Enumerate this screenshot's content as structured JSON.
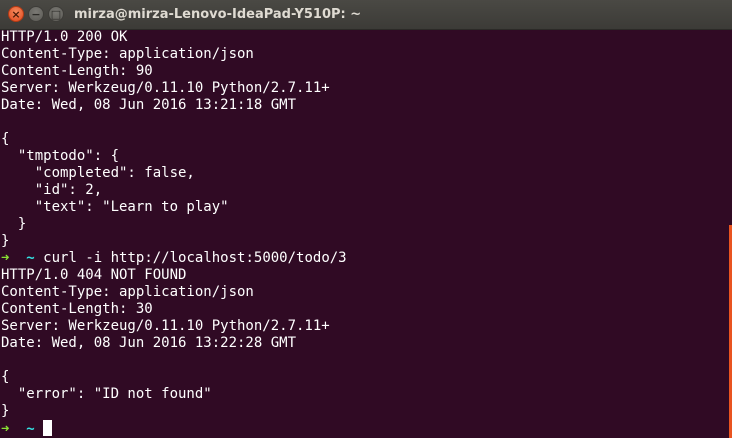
{
  "window": {
    "title": "mirza@mirza-Lenovo-IdeaPad-Y510P: ~",
    "close_glyph": "×",
    "min_glyph": "−",
    "max_glyph": "□"
  },
  "prompt": {
    "arrow": "➜",
    "dir": "~"
  },
  "terminal": {
    "lines": [
      "HTTP/1.0 200 OK",
      "Content-Type: application/json",
      "Content-Length: 90",
      "Server: Werkzeug/0.11.10 Python/2.7.11+",
      "Date: Wed, 08 Jun 2016 13:21:18 GMT",
      "",
      "{",
      "  \"tmptodo\": {",
      "    \"completed\": false,",
      "    \"id\": 2,",
      "    \"text\": \"Learn to play\"",
      "  }",
      "}"
    ],
    "command": "curl -i http://localhost:5000/todo/3",
    "lines2": [
      "HTTP/1.0 404 NOT FOUND",
      "Content-Type: application/json",
      "Content-Length: 30",
      "Server: Werkzeug/0.11.10 Python/2.7.11+",
      "Date: Wed, 08 Jun 2016 13:22:28 GMT",
      "",
      "{",
      "  \"error\": \"ID not found\"",
      "}"
    ]
  },
  "colors": {
    "background": "#300a24",
    "prompt_arrow": "#8ae234",
    "prompt_dir": "#34e2e2",
    "scrollbar": "#e95420"
  }
}
